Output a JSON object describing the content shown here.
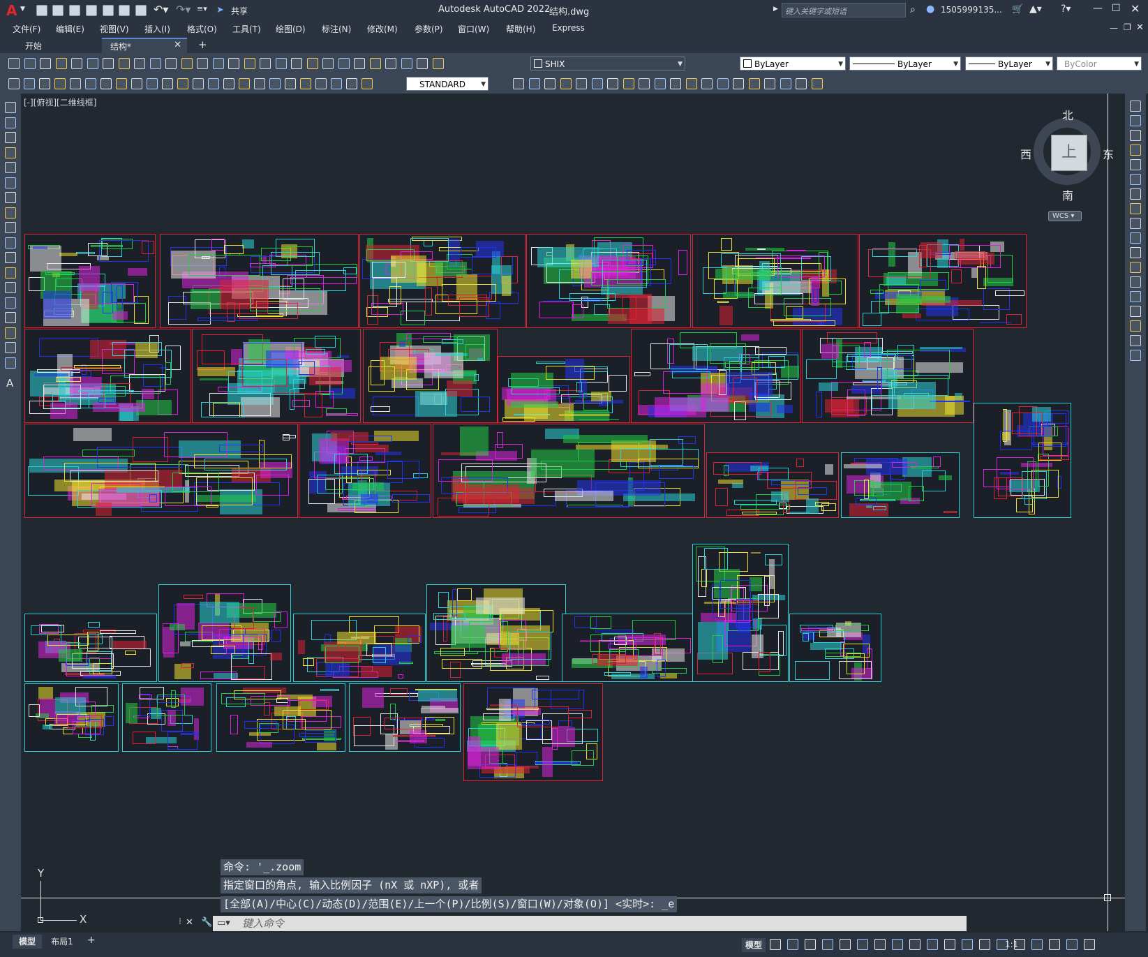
{
  "app": {
    "logo": "A",
    "title": "Autodesk AutoCAD 2022",
    "file": "结构.dwg",
    "share": "共享",
    "search_placeholder": "键入关键字或短语",
    "user": "1505999135...",
    "window_controls": [
      "minimize",
      "maximize",
      "close"
    ]
  },
  "menu": [
    "文件(F)",
    "编辑(E)",
    "视图(V)",
    "插入(I)",
    "格式(O)",
    "工具(T)",
    "绘图(D)",
    "标注(N)",
    "修改(M)",
    "参数(P)",
    "窗口(W)",
    "帮助(H)",
    "Express"
  ],
  "tabs": [
    {
      "label": "开始",
      "active": false
    },
    {
      "label": "结构*",
      "active": true
    }
  ],
  "toolbar1": {
    "layer": "SHIX",
    "color": "ByLayer",
    "linetype": "ByLayer",
    "lineweight": "ByLayer",
    "plotstyle": "ByColor"
  },
  "toolbar2": {
    "textstyle": "STANDARD"
  },
  "viewport": {
    "label": "[-][俯视][二维线框]",
    "viewcube": {
      "north": "北",
      "south": "南",
      "east": "东",
      "west": "西",
      "top": "上"
    },
    "wcs": "WCS",
    "ucs_x": "X",
    "ucs_y": "Y"
  },
  "command": {
    "history": [
      "命令: '_.zoom",
      "指定窗口的角点, 输入比例因子 (nX 或 nXP), 或者",
      "[全部(A)/中心(C)/动态(D)/范围(E)/上一个(P)/比例(S)/窗口(W)/对象(O)] <实时>: _e"
    ],
    "placeholder": "键入命令"
  },
  "layout_tabs": [
    "模型",
    "布局1"
  ],
  "status": {
    "mode": "模型",
    "scale": "1:1"
  },
  "colors": {
    "background": "#212830",
    "chrome": "#2b3340",
    "toolbar": "#3a4656",
    "frame_red": "#dd2233",
    "frame_cyan": "#2ad1d6",
    "accent_yellow": "#f0e030",
    "accent_green": "#22cc44",
    "accent_blue": "#2233ee",
    "accent_magenta": "#dd22dd"
  }
}
